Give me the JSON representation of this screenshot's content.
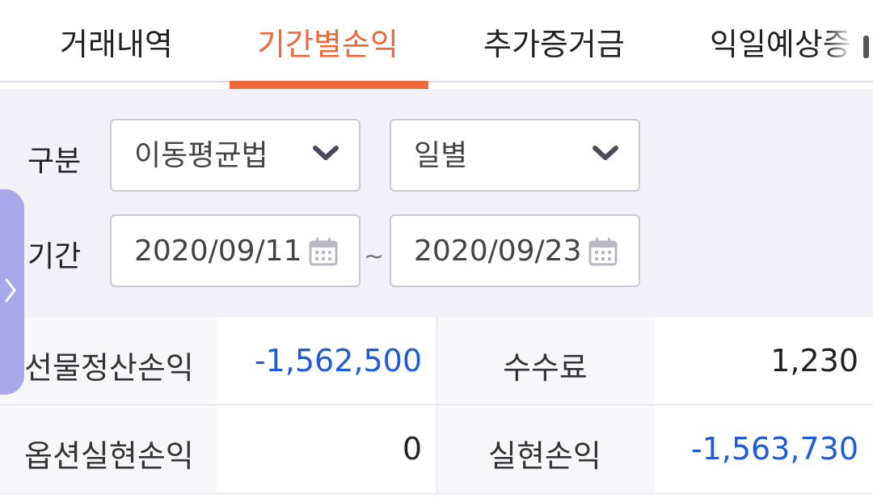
{
  "tabs": [
    {
      "label": "거래내역",
      "active": false
    },
    {
      "label": "기간별손익",
      "active": true
    },
    {
      "label": "추가증거금",
      "active": false
    },
    {
      "label": "익일예상증",
      "active": false
    }
  ],
  "filter": {
    "type_label": "구분",
    "method_select": "이동평균법",
    "period_unit_select": "일별",
    "period_label": "기간",
    "start_date": "2020/09/11",
    "date_separator": "~",
    "end_date": "2020/09/23"
  },
  "summary": {
    "futures_pnl_label": "선물정산손익",
    "futures_pnl_value": "-1,562,500",
    "fee_label": "수수료",
    "fee_value": "1,230",
    "option_pnl_label": "옵션실현손익",
    "option_pnl_value": "0",
    "realized_pnl_label": "실현손익",
    "realized_pnl_value": "-1,563,730"
  },
  "colors": {
    "accent": "#f0673a",
    "negative": "#1e5bd8",
    "drawer": "#a9a6e9"
  },
  "icons": {
    "dropdown": "chevron-down-icon",
    "date": "calendar-icon",
    "drawer": "chevron-right-icon"
  }
}
